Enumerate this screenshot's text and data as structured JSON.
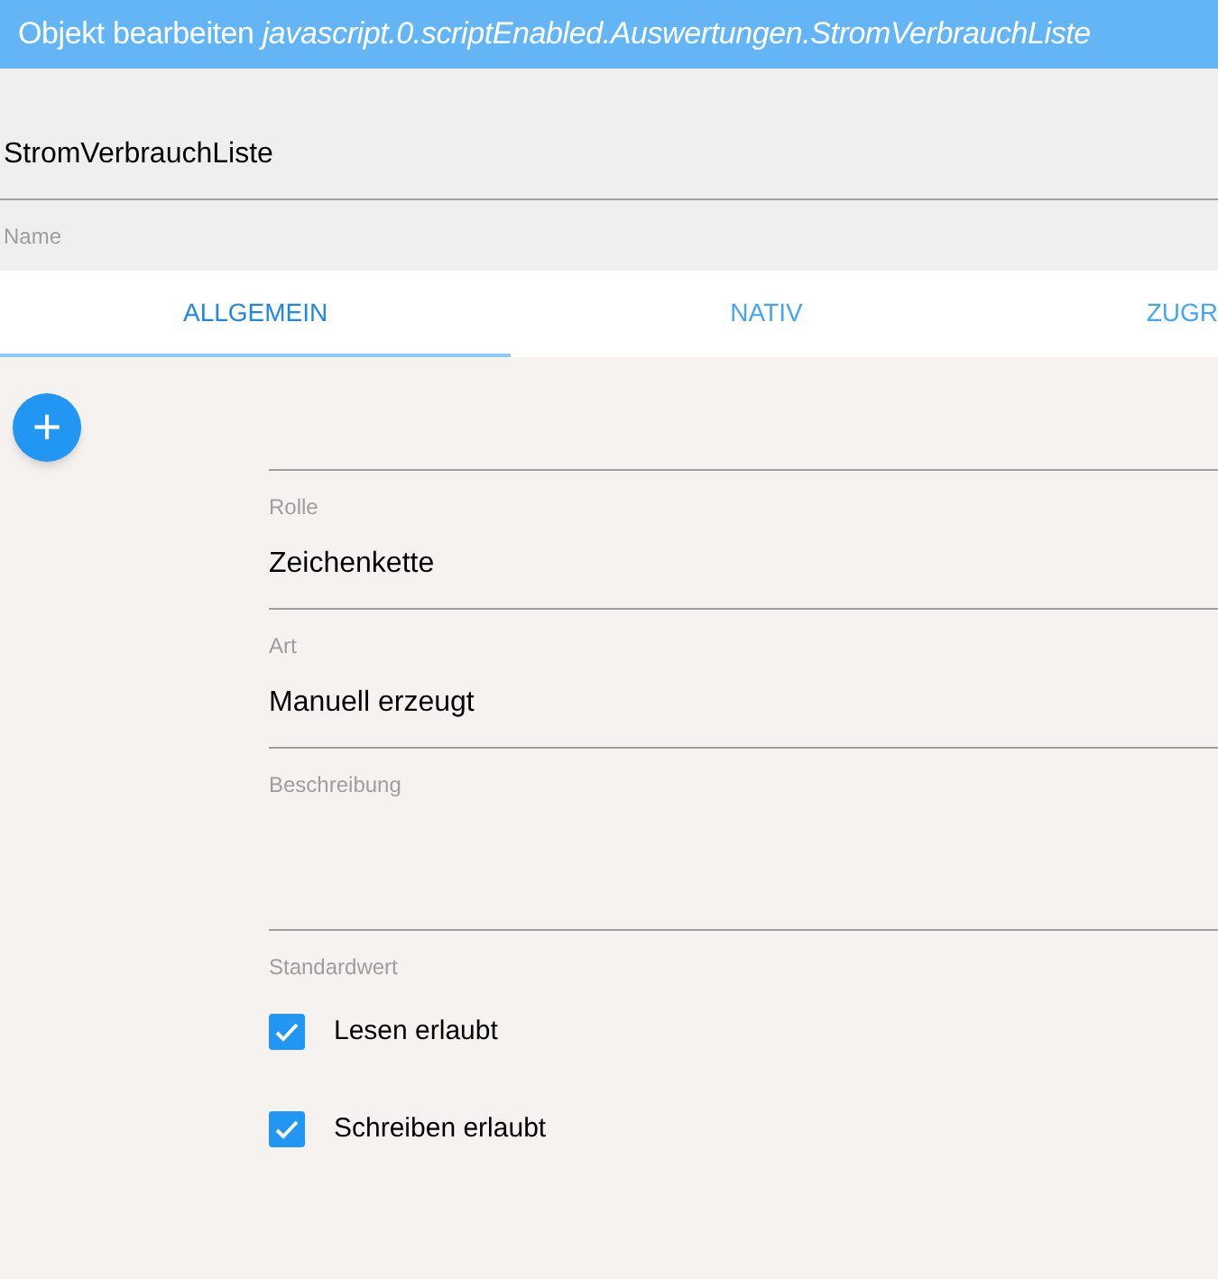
{
  "window": {
    "title": "Objekt bearbeiten *javascript.0.scriptEnabled.Auswertungen.StromVerbrauchListe*"
  },
  "name_field": {
    "value": "StromVerbrauchListe",
    "helper": "Name"
  },
  "tabs": [
    {
      "label": "ALLGEMEIN",
      "selected": true
    },
    {
      "label": "NATIV",
      "selected": false
    },
    {
      "label": "ZUGR",
      "selected": false
    }
  ],
  "add_button": {
    "label": "+"
  },
  "fields": [
    {
      "helper": "Rolle",
      "kind": "line"
    },
    {
      "value": "Zeichenkette",
      "helper": "Art",
      "kind": "line"
    },
    {
      "value": "Manuell erzeugt",
      "helper": "Beschreibung",
      "kind": "line"
    },
    {
      "helper": "Standardwert",
      "kind": "multiline"
    }
  ],
  "checkboxes": [
    {
      "label": "Lesen erlaubt",
      "checked": true
    },
    {
      "label": "Schreiben erlaubt",
      "checked": true
    }
  ]
}
